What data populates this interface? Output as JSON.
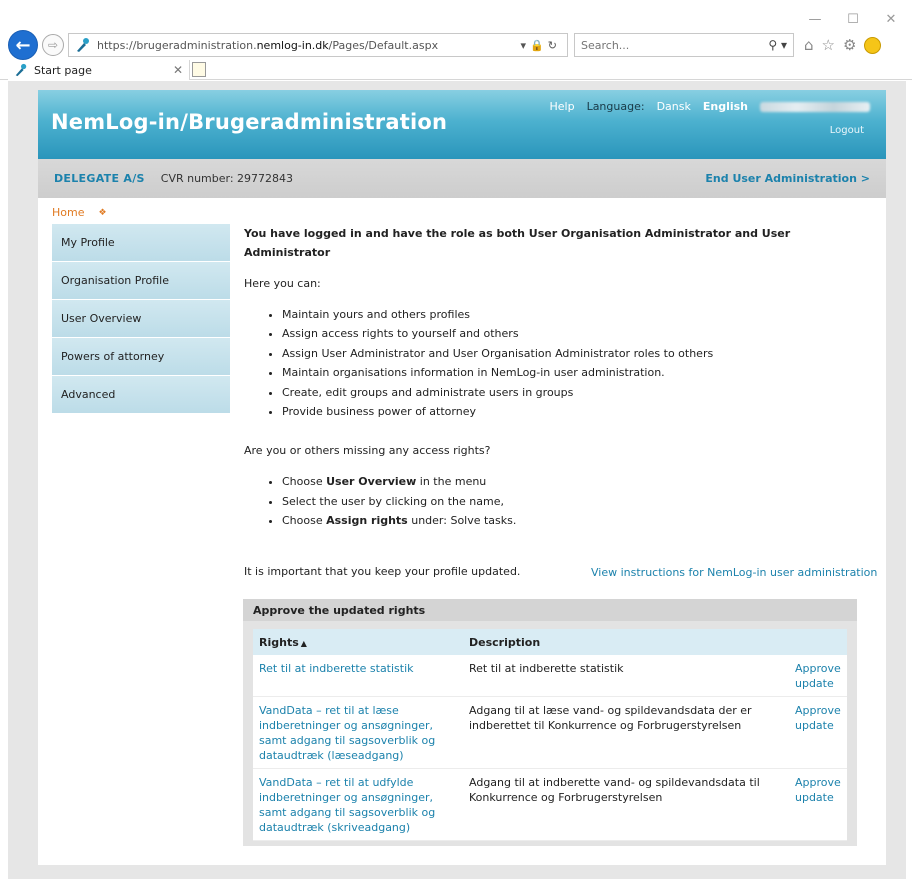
{
  "browser": {
    "url_prefix": "https://brugeradministration.",
    "url_domain": "nemlog-in.dk",
    "url_path": "/Pages/Default.aspx",
    "search_placeholder": "Search...",
    "tab_title": "Start page"
  },
  "header": {
    "brand": "NemLog-in/Brugeradministration",
    "help": "Help",
    "language_label": "Language:",
    "lang_dansk": "Dansk",
    "lang_english": "English",
    "logout": "Logout"
  },
  "subheader": {
    "org_name": "DELEGATE A/S",
    "cvr": "CVR number: 29772843",
    "end_user": "End User Administration >"
  },
  "breadcrumb": {
    "home": "Home"
  },
  "sidebar": {
    "items": [
      {
        "label": "My Profile"
      },
      {
        "label": "Organisation Profile"
      },
      {
        "label": "User Overview"
      },
      {
        "label": "Powers of attorney"
      },
      {
        "label": "Advanced"
      }
    ]
  },
  "main": {
    "headline": "You have logged in and have the role as both User Organisation Administrator and User Administrator",
    "intro": "Here you can:",
    "bullets": [
      "Maintain yours and others profiles",
      "Assign access rights to yourself and others",
      "Assign User Administrator and User Organisation Administrator roles to others",
      "Maintain organisations information in NemLog-in user administration.",
      "Create, edit groups and administrate users in groups",
      "Provide business power of attorney"
    ],
    "missing_q": "Are you or others missing any access rights?",
    "steps": {
      "s1_pre": "Choose ",
      "s1_bold": "User Overview",
      "s1_post": " in the menu",
      "s2": "Select the user by clicking on the name,",
      "s3_pre": "Choose ",
      "s3_bold": "Assign rights",
      "s3_post": " under: Solve tasks."
    },
    "keep_updated": "It is important that you keep your profile updated.",
    "instructions_link": "View instructions for NemLog-in user administration"
  },
  "approve": {
    "title": "Approve the updated rights",
    "col_rights": "Rights",
    "col_description": "Description",
    "rows": [
      {
        "right": "Ret til at indberette statistik",
        "description": "Ret til at indberette statistik",
        "action": "Approve update"
      },
      {
        "right": "VandData – ret til at læse indberetninger og ansøgninger, samt adgang til sagsoverblik og dataudtræk (læseadgang)",
        "description": "Adgang til at læse vand- og spildevandsdata der er indberettet til Konkurrence og Forbrugerstyrelsen",
        "action": "Approve update"
      },
      {
        "right": "VandData – ret til at udfylde indberetninger og ansøgninger, samt adgang til sagsoverblik og dataudtræk (skriveadgang)",
        "description": "Adgang til at indberette vand- og spildevandsdata til Konkurrence og Forbrugerstyrelsen",
        "action": "Approve update"
      }
    ]
  }
}
